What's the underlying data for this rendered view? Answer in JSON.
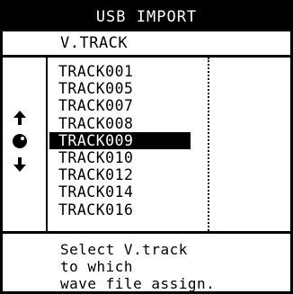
{
  "title": "USB IMPORT",
  "subheader": "V.TRACK",
  "tracks": [
    "TRACK001",
    "TRACK005",
    "TRACK007",
    "TRACK008",
    "TRACK009",
    "TRACK010",
    "TRACK012",
    "TRACK014",
    "TRACK016"
  ],
  "selected_track": "TRACK009",
  "nav_icons": [
    "arrow-up-icon",
    "jog-dial-icon",
    "arrow-down-icon"
  ],
  "help": {
    "line1": "Select V.track",
    "line2": "to which",
    "line3": "wave file assign."
  }
}
